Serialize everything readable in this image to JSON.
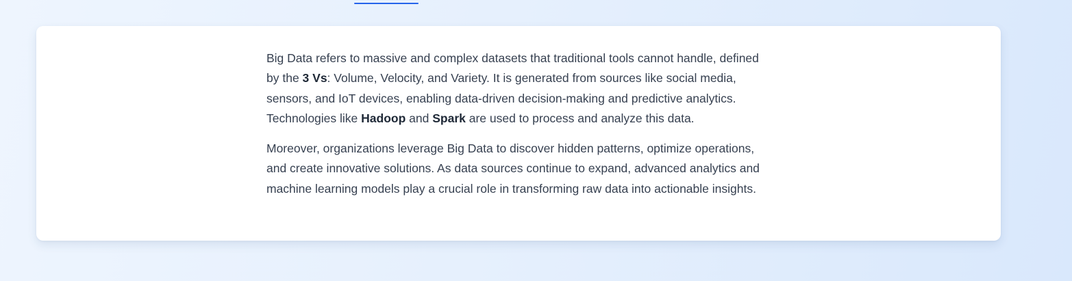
{
  "accent_color": "#2563eb",
  "text_color": "#374151",
  "paragraph_1": {
    "part1": "Big Data refers to massive and complex datasets that traditional tools cannot handle, defined by the ",
    "bold1": "3 Vs",
    "part2": ": Volume, Velocity, and Variety. It is generated from sources like social media, sensors, and IoT devices, enabling data-driven decision-making and predictive analytics. Technologies like ",
    "bold2": "Hadoop",
    "part3": " and ",
    "bold3": "Spark",
    "part4": " are used to process and analyze this data."
  },
  "paragraph_2": {
    "text": "Moreover, organizations leverage Big Data to discover hidden patterns, optimize operations, and create innovative solutions. As data sources continue to expand, advanced analytics and machine learning models play a crucial role in transforming raw data into actionable insights."
  }
}
